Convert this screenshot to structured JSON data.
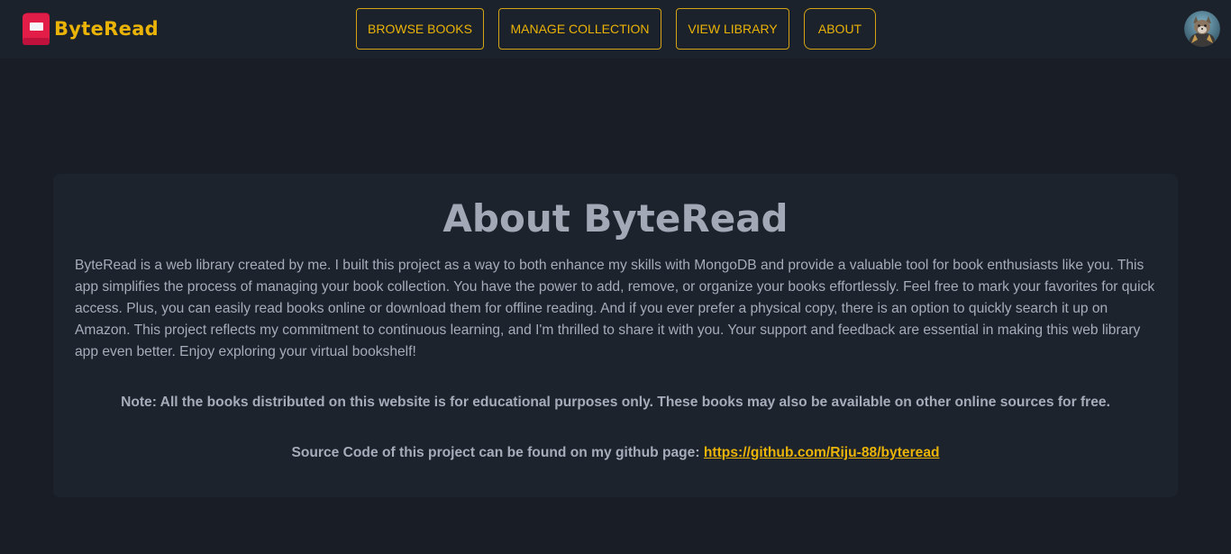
{
  "app": {
    "name": "ByteRead",
    "accent_color": "#eab308",
    "logo_icon": "book-icon"
  },
  "nav": {
    "items": [
      {
        "label": "BROWSE BOOKS"
      },
      {
        "label": "MANAGE COLLECTION"
      },
      {
        "label": "VIEW LIBRARY"
      },
      {
        "label": "ABOUT"
      }
    ]
  },
  "user": {
    "avatar_icon": "user-avatar"
  },
  "about": {
    "title": "About ByteRead",
    "body": "ByteRead is a web library created by me. I built this project as a way to both enhance my skills with MongoDB and provide a valuable tool for book enthusiasts like you. This app simplifies the process of managing your book collection. You have the power to add, remove, or organize your books effortlessly. Feel free to mark your favorites for quick access. Plus, you can easily read books online or download them for offline reading. And if you ever prefer a physical copy, there is an option to quickly search it up on Amazon. This project reflects my commitment to continuous learning, and I'm thrilled to share it with you. Your support and feedback are essential in making this web library app even better. Enjoy exploring your virtual bookshelf!",
    "note": "Note: All the books distributed on this website is for educational purposes only. These books may also be available on other online sources for free.",
    "source_prefix": "Source Code of this project can be found on my github page:",
    "source_link": "https://github.com/Riju-88/byteread"
  }
}
